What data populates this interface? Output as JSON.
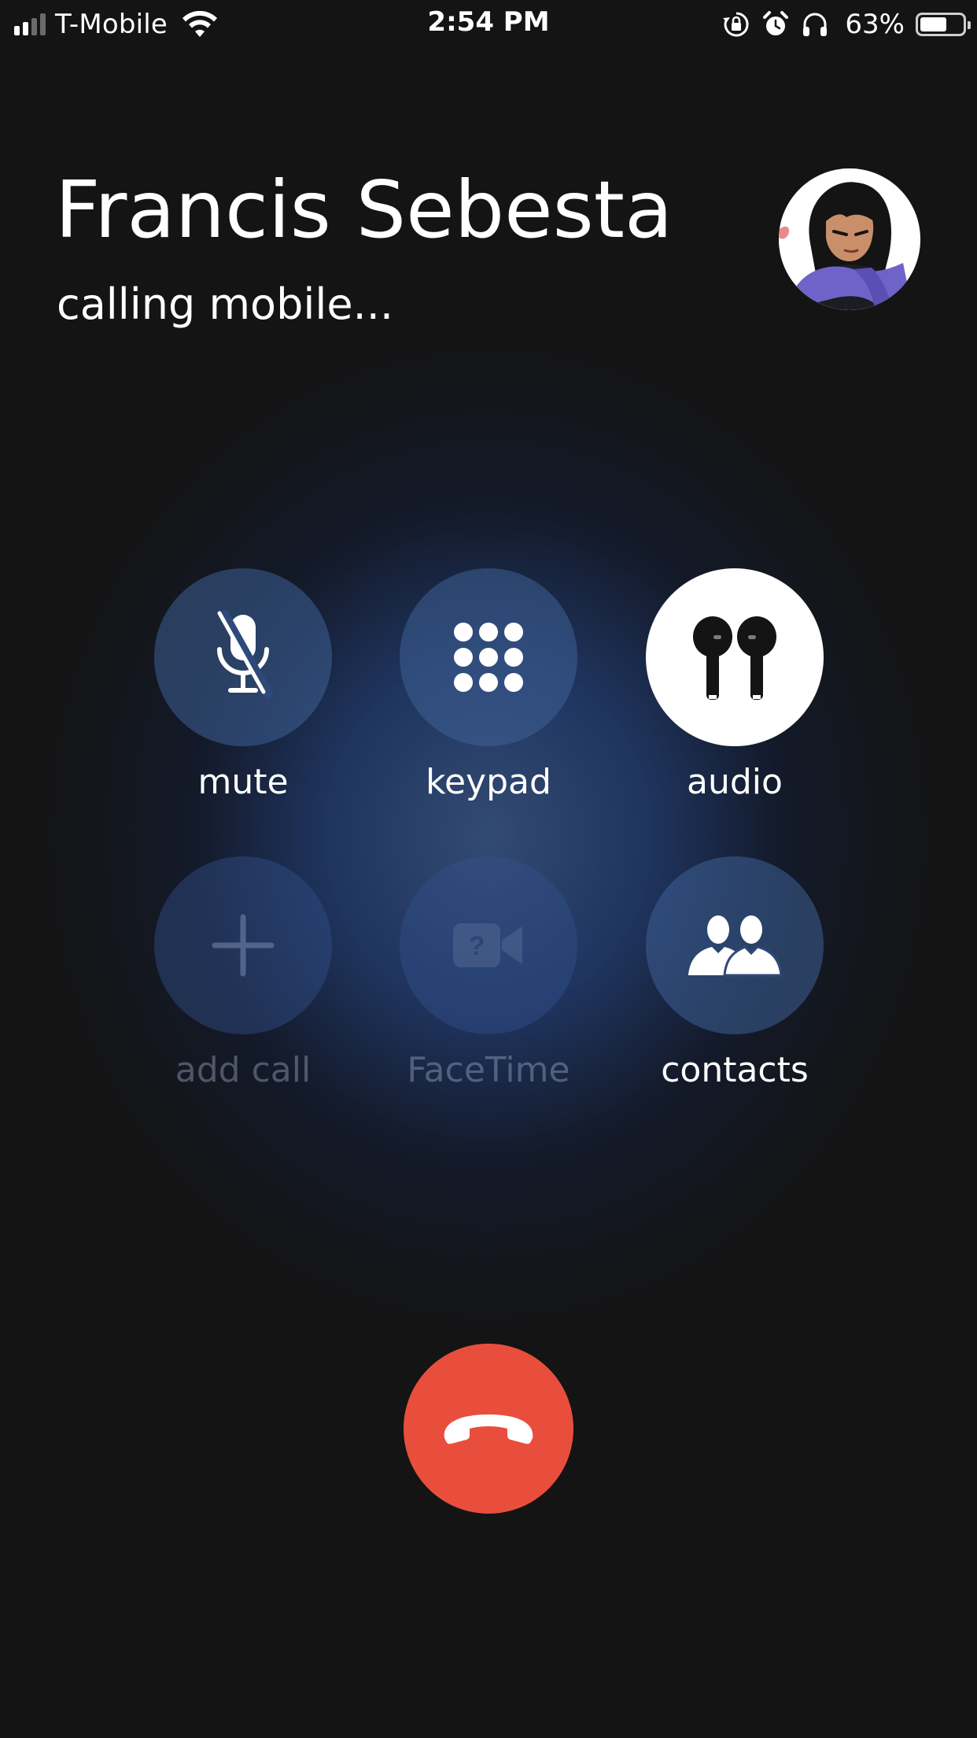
{
  "status_bar": {
    "carrier": "T-Mobile",
    "time": "2:54 PM",
    "battery_percent": "63%",
    "battery_level": 0.63,
    "signal_bars_active": 2,
    "signal_bars_total": 4,
    "icons": [
      "signal-icon",
      "wifi-icon",
      "orientation-lock-icon",
      "alarm-icon",
      "headphones-icon",
      "battery-icon"
    ]
  },
  "caller": {
    "name": "Francis Sebesta",
    "status": "calling mobile..."
  },
  "controls": {
    "mute": {
      "label": "mute",
      "icon": "mic-off-icon",
      "enabled": true
    },
    "keypad": {
      "label": "keypad",
      "icon": "keypad-icon",
      "enabled": true
    },
    "audio": {
      "label": "audio",
      "icon": "airpods-icon",
      "enabled": true,
      "active": true
    },
    "add_call": {
      "label": "add call",
      "icon": "plus-icon",
      "enabled": false
    },
    "facetime": {
      "label": "FaceTime",
      "icon": "video-camera-icon",
      "enabled": false
    },
    "contacts": {
      "label": "contacts",
      "icon": "contacts-icon",
      "enabled": true
    }
  },
  "end_call": {
    "icon": "phone-hangup-icon"
  },
  "colors": {
    "background": "#141414",
    "end_call_red": "#e94e3d",
    "button_blue": "#3e6096",
    "active_white": "#ffffff"
  }
}
